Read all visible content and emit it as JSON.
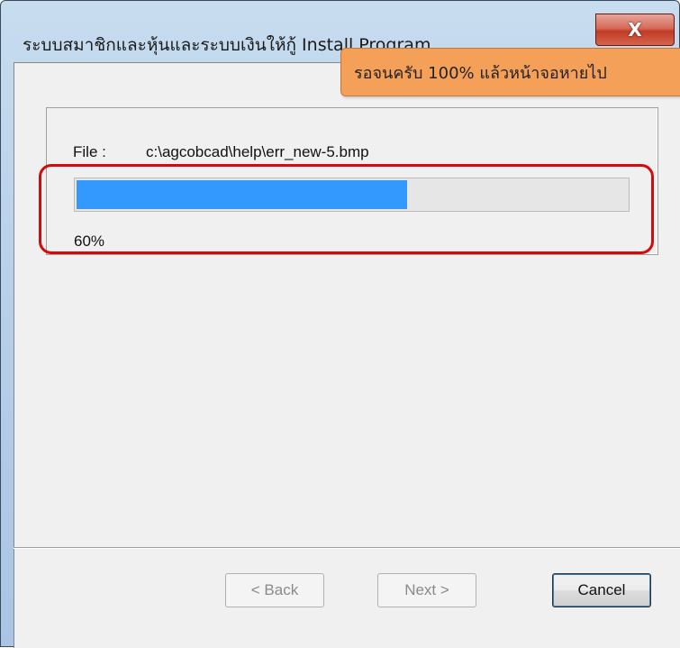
{
  "window": {
    "title": "ระบบสมาชิกและหุ้นและระบบเงินให้กู้ Install Program",
    "close_glyph": "X"
  },
  "tooltip": {
    "text": "รอจนครับ 100% แล้วหน้าจอหายไป"
  },
  "install": {
    "file_label": "File :",
    "file_path": "c:\\agcobcad\\help\\err_new-5.bmp",
    "progress_fraction": 0.6,
    "percent_text": "60%"
  },
  "buttons": {
    "back": "< Back",
    "next": "Next >",
    "cancel": "Cancel"
  },
  "colors": {
    "progress_fill": "#3399ff",
    "highlight": "#d60a0a",
    "tooltip_bg": "#f5a058"
  }
}
